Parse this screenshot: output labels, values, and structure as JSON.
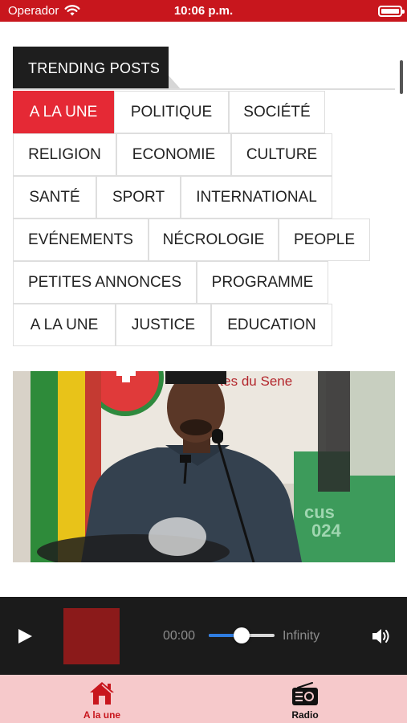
{
  "status_bar": {
    "carrier": "Operador",
    "time": "10:06 p.m.",
    "wifi_icon": "wifi-icon",
    "battery_icon": "battery-icon"
  },
  "trending": {
    "title": "TRENDING POSTS"
  },
  "categories": [
    {
      "label": "A LA UNE",
      "active": true
    },
    {
      "label": "POLITIQUE"
    },
    {
      "label": "SOCIÉTÉ"
    },
    {
      "label": "RELIGION"
    },
    {
      "label": "ECONOMIE"
    },
    {
      "label": "CULTURE"
    },
    {
      "label": "SANTÉ"
    },
    {
      "label": "SPORT"
    },
    {
      "label": "INTERNATIONAL"
    },
    {
      "label": "EVÉNEMENTS"
    },
    {
      "label": "NÉCROLOGIE"
    },
    {
      "label": "PEOPLE"
    },
    {
      "label": "PETITES ANNONCES"
    },
    {
      "label": "PROGRAMME"
    },
    {
      "label": "A LA UNE"
    },
    {
      "label": "JUSTICE"
    },
    {
      "label": "EDUCATION"
    }
  ],
  "hero": {
    "banner_text": "otes du Sene",
    "banner_text_2": "cus",
    "banner_text_3": "024"
  },
  "player": {
    "current_time": "00:00",
    "total_time": "Infinity",
    "volume_level": 0.5,
    "play_icon": "play-icon",
    "volume_icon": "volume-icon"
  },
  "tabbar": {
    "tabs": [
      {
        "label": "A la une",
        "icon": "home-icon",
        "active": true
      },
      {
        "label": "Radio",
        "icon": "radio-icon",
        "active": false
      }
    ]
  },
  "colors": {
    "accent": "#e52935",
    "status_bar": "#c8161d",
    "player_bg": "#1b1b1b",
    "album_art": "#8b1a1a",
    "tabbar_bg": "#f6c9cb",
    "slider_fill": "#2f7de1"
  }
}
